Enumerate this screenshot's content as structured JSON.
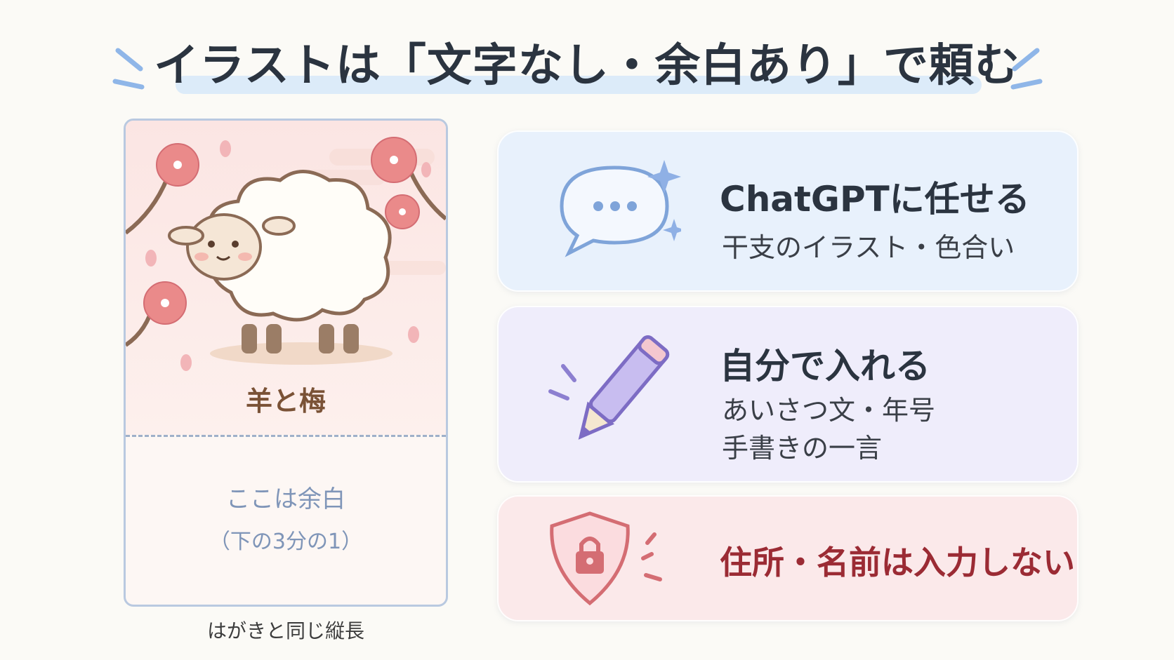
{
  "title": "イラストは「文字なし・余白あり」で頼む",
  "postcard": {
    "caption": "羊と梅",
    "margin_label": "ここは余白",
    "margin_sub": "（下の3分の1）",
    "footer": "はがきと同じ縦長"
  },
  "steps": [
    {
      "title": "ChatGPTに任せる",
      "lines": [
        "干支のイラスト・色合い"
      ],
      "icon": "chat-bubble-icon",
      "bg": "#e8f1fc"
    },
    {
      "title": "自分で入れる",
      "lines": [
        "あいさつ文・年号",
        "手書きの一言"
      ],
      "icon": "pencil-icon",
      "bg": "#efedfb"
    },
    {
      "title": "住所・名前は入力しない",
      "lines": [],
      "icon": "shield-lock-icon",
      "bg": "#fbe9ea",
      "accent": "#9b2b34"
    }
  ]
}
